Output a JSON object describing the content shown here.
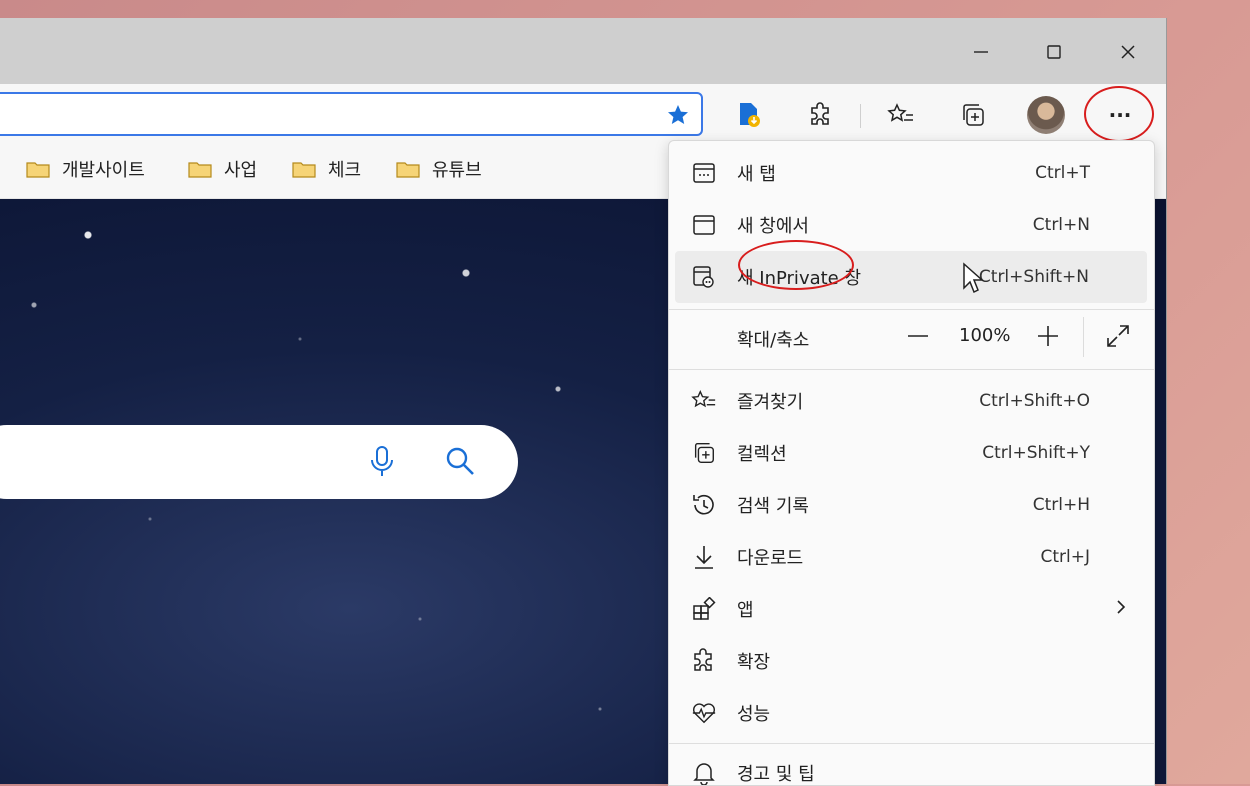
{
  "toolbar": {
    "more_label": "···"
  },
  "bookmarks": [
    {
      "label": "개발사이트"
    },
    {
      "label": "사업"
    },
    {
      "label": "체크"
    },
    {
      "label": "유튜브"
    }
  ],
  "menu": {
    "items": [
      {
        "label": "새 탭",
        "shortcut": "Ctrl+T",
        "icon": "new-tab-icon"
      },
      {
        "label": "새 창에서",
        "shortcut": "Ctrl+N",
        "icon": "new-window-icon"
      },
      {
        "label": "새 InPrivate 창",
        "shortcut": "Ctrl+Shift+N",
        "icon": "inprivate-icon"
      },
      {
        "label": "확대/축소",
        "icon": ""
      },
      {
        "label": "즐겨찾기",
        "shortcut": "Ctrl+Shift+O",
        "icon": "favorites-icon"
      },
      {
        "label": "컬렉션",
        "shortcut": "Ctrl+Shift+Y",
        "icon": "collections-icon"
      },
      {
        "label": "검색 기록",
        "shortcut": "Ctrl+H",
        "icon": "history-icon"
      },
      {
        "label": "다운로드",
        "shortcut": "Ctrl+J",
        "icon": "download-icon"
      },
      {
        "label": "앱",
        "icon": "apps-icon"
      },
      {
        "label": "확장",
        "icon": "extensions-icon"
      },
      {
        "label": "성능",
        "icon": "performance-icon"
      },
      {
        "label": "경고 및 팁",
        "icon": "bell-icon"
      }
    ],
    "zoom": {
      "value": "100%"
    }
  },
  "colors": {
    "accent": "#3b78e7",
    "highlight_ring": "#d81d1d",
    "star": "#1a6fd6"
  }
}
